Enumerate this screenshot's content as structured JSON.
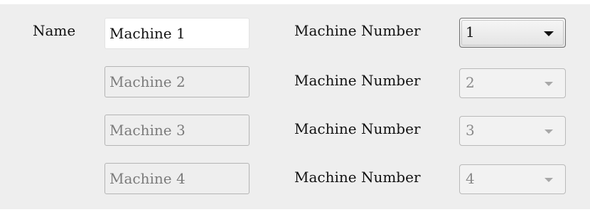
{
  "form": {
    "name_label": "Name",
    "rows": [
      {
        "name_value": "Machine 1",
        "number_label": "Machine Number",
        "number_value": "1",
        "enabled": true
      },
      {
        "name_value": "Machine 2",
        "number_label": "Machine Number",
        "number_value": "2",
        "enabled": false
      },
      {
        "name_value": "Machine 3",
        "number_label": "Machine Number",
        "number_value": "3",
        "enabled": false
      },
      {
        "name_value": "Machine 4",
        "number_label": "Machine Number",
        "number_value": "4",
        "enabled": false
      }
    ]
  },
  "icons": {
    "dropdown_arrow": "chevron-down-icon"
  },
  "colors": {
    "panel_background": "#eeeeee",
    "enabled_text": "#111111",
    "disabled_text": "#7b7b7b",
    "disabled_border": "#b4b4b4"
  }
}
